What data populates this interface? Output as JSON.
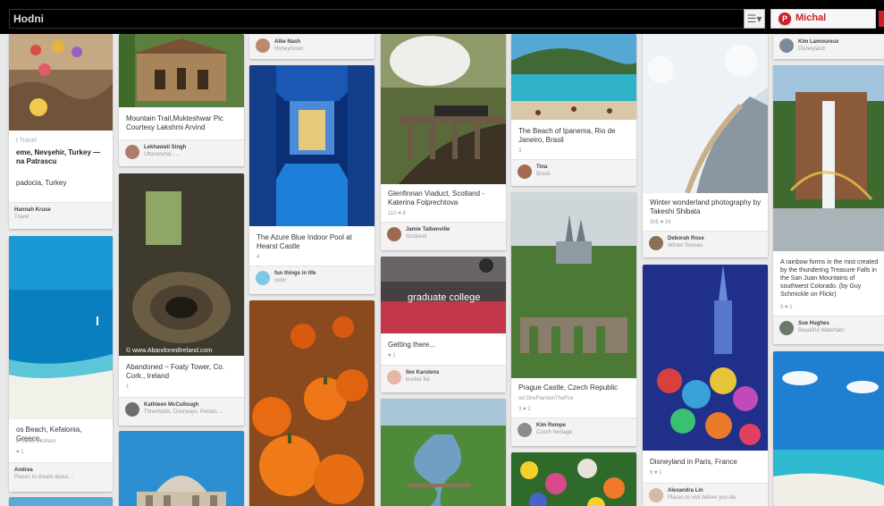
{
  "browser": {
    "url_text": "Hodni"
  },
  "user": {
    "name": "Michal"
  },
  "pins": {
    "p1": {
      "desc_a": "t Travel",
      "desc_b": "eme, Nevşehir, Turkey —",
      "desc_c": "na Patrascu",
      "desc_d": "padocia, Turkey",
      "via_name": "Hannah Kruse",
      "via_board": "Travel"
    },
    "p2": {
      "desc": "os Beach, Kefalonia, Greece.",
      "meta": "d Steve Oksham",
      "stats": "♥ 1",
      "via_name": "Andrea",
      "via_board": "Places to dream about...."
    },
    "p3": {
      "desc": "Mountain Trail,Mukteshwar Pic Courtesy Lakshmi Arvind",
      "via_name": "Lekhawati Singh",
      "via_board": "Uttaranchal ...."
    },
    "p4": {
      "watermark": "© www.AbandonedIreland.com",
      "desc": "Abandoned ~ Foaty Tower, Co. Cork., Ireland",
      "stats": "1",
      "via_name": "Kathleen McCullough",
      "via_board": "Thresholds, Doorways, Portals ..."
    },
    "p5": {
      "via_name": "Allie Nash",
      "via_board": "Honeymoon"
    },
    "p6": {
      "desc": "The Azure Blue Indoor Pool at Hearst Castle",
      "stats": "4",
      "via_name": "fun things in life",
      "via_board": "color"
    },
    "p7": {
      "desc": "Glenfinnan Viaduct, Scotland - Katerina Folprechtova",
      "stats": "110   ♥ 8",
      "via_name": "Jamie Talbenville",
      "via_board": "Scotland"
    },
    "p8": {
      "overlay": "graduate college",
      "desc": "Getting there...",
      "stats": "♥ 1",
      "via_name": "Ilex Karstens",
      "via_board": "bucket list"
    },
    "p9": {
      "desc": "The Beach of Ipanema, Rio de Janeiro, Brasil",
      "stats": "3",
      "via_name": "Tina",
      "via_board": "Brasil"
    },
    "p10": {
      "desc": "Prague Castle, Czech Republic",
      "meta": "od OneFlameinTheFire",
      "stats": "3   ♥ 2",
      "via_name": "Kim Rempe",
      "via_board": "Czech heritage"
    },
    "p11": {
      "desc": "Winter wonderland photography by Takeshi Shibata",
      "stats": "305   ♥ 34",
      "via_name": "Deborah Rose",
      "via_board": "Winter Scenes"
    },
    "p12": {
      "desc": "Disneyland in Paris, France",
      "stats": "6   ♥ 1",
      "via_name": "Alexandra Lin",
      "via_board": "Places to visit before you die"
    },
    "p13": {
      "via_name": "Kim Lamoureux",
      "via_board": "Disneyland"
    },
    "p14": {
      "desc": "A rainbow forms in the mist created by the thundering Treasure Falls in the San Juan Mountains of southwest Colorado. (by Guy Schmickle on Flickr)",
      "stats": "5   ♥ 1",
      "via_name": "Sue Hughes",
      "via_board": "Beautiful Waterfalls"
    }
  }
}
